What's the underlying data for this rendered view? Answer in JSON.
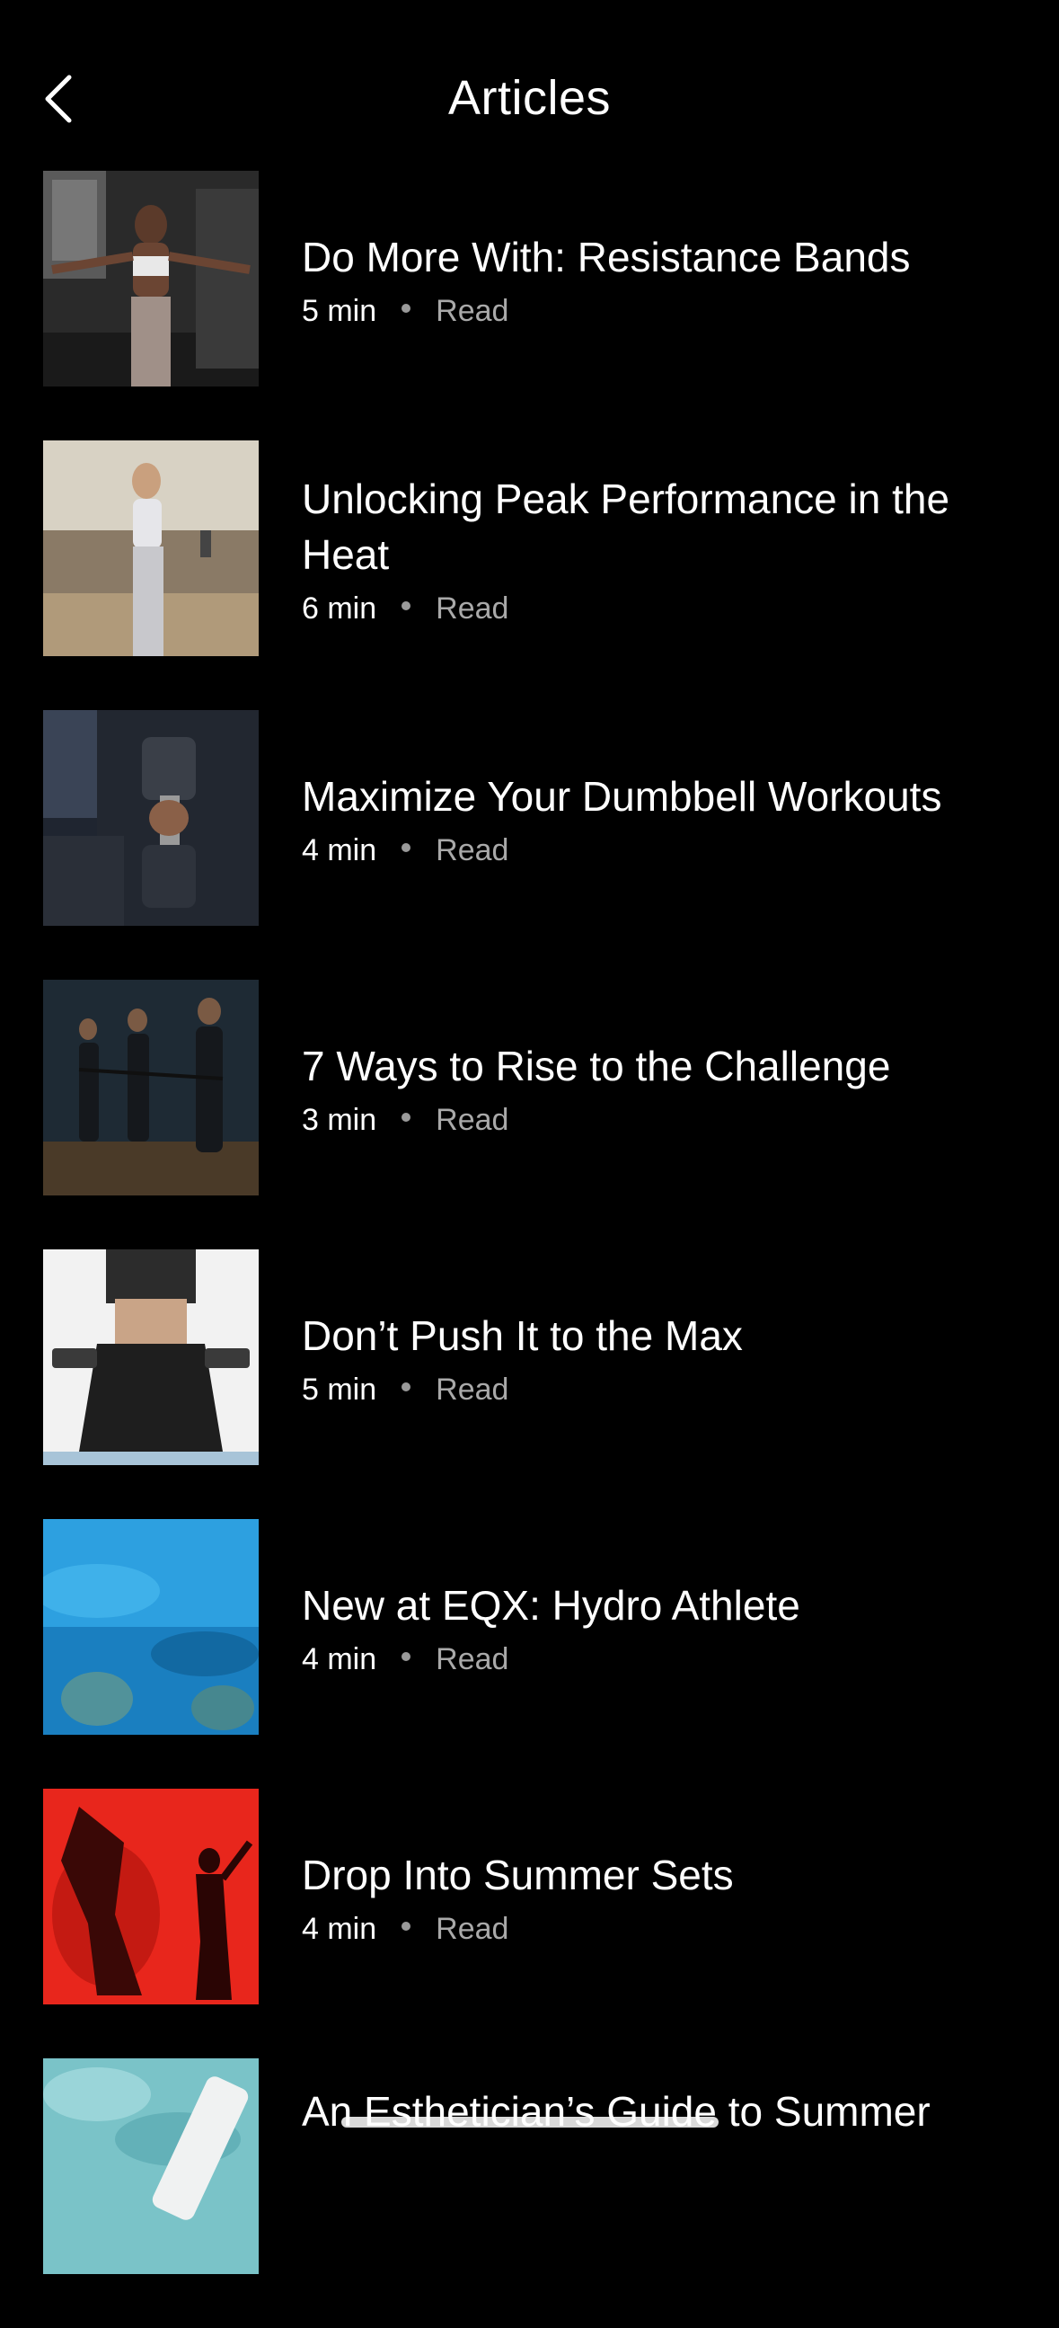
{
  "header": {
    "title": "Articles",
    "back_icon": "chevron-left-icon"
  },
  "articles": [
    {
      "title": "Do More With: Resistance Bands",
      "duration": "5 min",
      "type": "Read",
      "image": "woman-resistance-bands-photo"
    },
    {
      "title": "Unlocking Peak Performance in the Heat",
      "duration": "6 min",
      "type": "Read",
      "image": "woman-outdoor-running-photo"
    },
    {
      "title": "Maximize Your Dumbbell Workouts",
      "duration": "4 min",
      "type": "Read",
      "image": "dumbbell-closeup-photo"
    },
    {
      "title": "7 Ways to Rise to the Challenge",
      "duration": "3 min",
      "type": "Read",
      "image": "group-fitness-class-photo"
    },
    {
      "title": "Don’t Push It to the Max",
      "duration": "5 min",
      "type": "Read",
      "image": "kneeling-dumbbell-photo"
    },
    {
      "title": "New at EQX: Hydro Athlete",
      "duration": "4 min",
      "type": "Read",
      "image": "underwater-pool-photo"
    },
    {
      "title": "Drop Into Summer Sets",
      "duration": "4 min",
      "type": "Read",
      "image": "red-silhouette-dance-photo"
    },
    {
      "title": "An Esthetician’s Guide to Summer",
      "duration": "",
      "type": "",
      "image": "skincare-water-photo"
    }
  ],
  "colors": {
    "background": "#000000",
    "text": "#ffffff",
    "meta_secondary": "#a9a9a9"
  }
}
